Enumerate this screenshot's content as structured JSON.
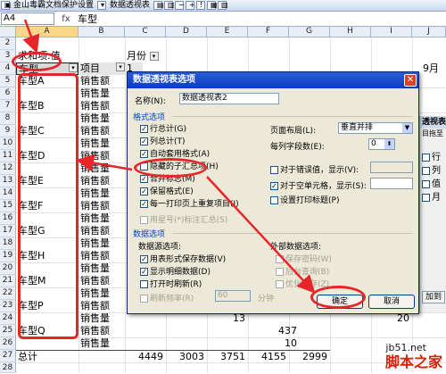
{
  "toolbar": {
    "item1": "金山毒霸文档保护设置",
    "item2": "数据透视表"
  },
  "formula": {
    "namebox": "A4",
    "fx": "fx",
    "value": "车型"
  },
  "columns": [
    "A",
    "B",
    "C",
    "D",
    "E",
    "F",
    "G",
    "H",
    "I",
    "J"
  ],
  "rows": [
    "2",
    "3",
    "4",
    "5",
    "6",
    "7",
    "8",
    "9",
    "10",
    "11",
    "12",
    "13",
    "14",
    "15",
    "16",
    "17",
    "18",
    "19",
    "20",
    "21",
    "22",
    "23",
    "24",
    "25",
    "26",
    "27",
    "28"
  ],
  "sheet": {
    "a3": "求和项:值",
    "c3": "月份",
    "a4": "车型",
    "b4": "项目",
    "month_1": "1",
    "month_9": "9月",
    "cars": [
      "车型A",
      "车型B",
      "车型C",
      "车型D",
      "车型E",
      "车型F",
      "车型G",
      "车型H",
      "车型M",
      "车型P",
      "车型Q"
    ],
    "sales_amount": "销售额",
    "sales_qty": "销售量",
    "total_label": "总计",
    "row24_val1": "13",
    "row24_val2": "20",
    "row25_val": "437",
    "row26_val": "10",
    "total_values": [
      "4449",
      "3003",
      "3751",
      "4155",
      "2999"
    ]
  },
  "dialog": {
    "title": "数据透视表选项",
    "name_label": "名称(N):",
    "name_value": "数据透视表2",
    "format_section": "格式选项",
    "opt_grand_rows": "行总计(G)",
    "opt_grand_cols": "列总计(T)",
    "opt_autoformat": "自动套用格式(A)",
    "opt_subtotal_hidden": "隐藏的子汇总项(H)",
    "opt_merge_labels": "合并标志(M)",
    "opt_keep_format": "保留格式(E)",
    "opt_repeat_items": "每一打印页上重复项目(I)",
    "opt_mark_totals": "用星号(*)标注汇总(S)",
    "layout_label": "页面布局(L):",
    "layout_value": "垂直并排",
    "fields_per_col_label": "每列字段数(E):",
    "fields_per_col_value": "0",
    "error_display_label": "对于错误值，显示(V):",
    "empty_display_label": "对于空单元格，显示(S):",
    "print_titles_label": "设置打印标题(P)",
    "data_section": "数据选项",
    "data_source_label": "数据源选项:",
    "opt_save_data": "用表形式保存数据(V)",
    "opt_show_details": "显示明细数据(D)",
    "opt_refresh_open": "打开时刷新(R)",
    "opt_refresh_every": "刷新频率(R)",
    "refresh_value": "60",
    "refresh_unit": "分钟",
    "external_label": "外部数据选项:",
    "opt_save_password": "保存密码(W)",
    "opt_background_query": "后台查询(B)",
    "opt_optimize_memory": "优化内存(Z)",
    "ok_label": "确定",
    "cancel_label": "取消"
  },
  "sidepanel": {
    "title": "透视表",
    "hint": "目拖至",
    "items": [
      "行",
      "列",
      "值",
      "月"
    ],
    "add_button": "加到"
  },
  "watermark": {
    "site": "jb51.net",
    "name": "脚本之家"
  },
  "colors": {
    "annotation": "#e8262a",
    "title_bar": "#0a3dc0",
    "header_bg": "#e9eef6"
  }
}
